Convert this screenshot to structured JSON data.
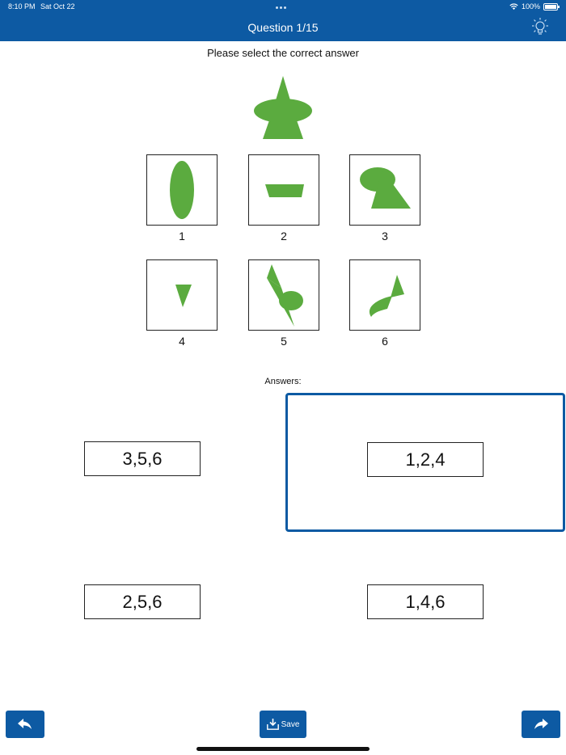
{
  "status": {
    "time": "8:10 PM",
    "date": "Sat Oct 22",
    "battery": "100%"
  },
  "header": {
    "title": "Question 1/15"
  },
  "prompt": "Please select the correct answer",
  "options": [
    {
      "number": "1"
    },
    {
      "number": "2"
    },
    {
      "number": "3"
    },
    {
      "number": "4"
    },
    {
      "number": "5"
    },
    {
      "number": "6"
    }
  ],
  "answers_label": "Answers:",
  "answers": [
    {
      "label": "3,5,6",
      "selected": false
    },
    {
      "label": "1,2,4",
      "selected": true
    },
    {
      "label": "2,5,6",
      "selected": false
    },
    {
      "label": "1,4,6",
      "selected": false
    }
  ],
  "footer": {
    "save_label": "Save"
  },
  "colors": {
    "header": "#0d5aa3",
    "shape": "#5bab3f",
    "selection": "#0d5aa3"
  }
}
